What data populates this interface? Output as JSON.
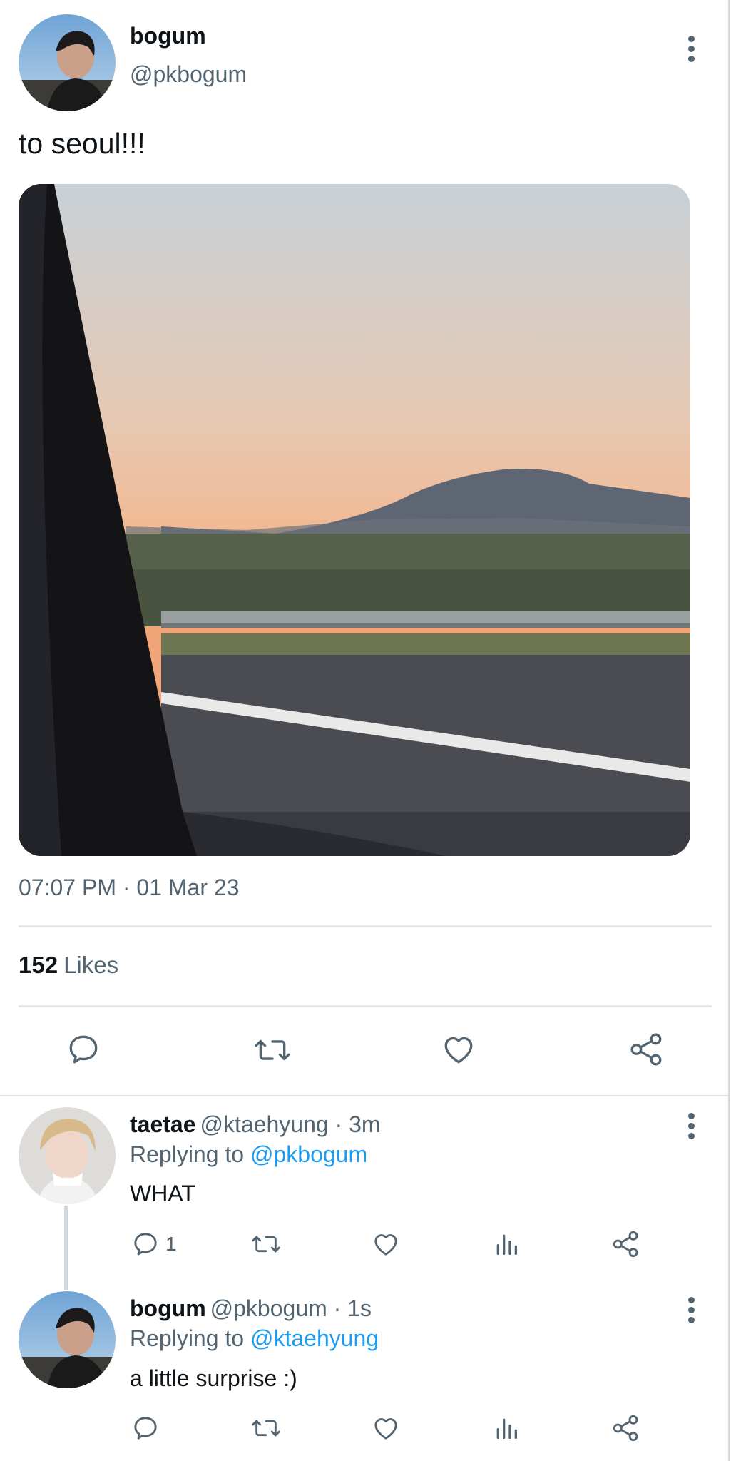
{
  "tweet": {
    "author_name": "bogum",
    "author_handle": "@pkbogum",
    "text": "to seoul!!!",
    "timestamp": "07:07 PM · 01 Mar 23",
    "likes_count": "152",
    "likes_label": "Likes"
  },
  "replies": [
    {
      "name": "taetae",
      "handle_time": "@ktaehyung · 3m",
      "replying_prefix": "Replying to",
      "replying_to": "@pkbogum",
      "text": "WHAT",
      "reply_count": "1"
    },
    {
      "name": "bogum",
      "handle_time": "@pkbogum · 1s",
      "replying_prefix": "Replying to",
      "replying_to": "@ktaehyung",
      "text": "a little surprise :)",
      "reply_count": ""
    }
  ],
  "colors": {
    "accent": "#1d9bf0",
    "secondary_text": "#536471",
    "icon": "#536471",
    "divider": "#e6e8ea"
  },
  "icons": [
    "more-vertical-icon",
    "reply-icon",
    "retweet-icon",
    "like-icon",
    "analytics-icon",
    "share-icon"
  ]
}
